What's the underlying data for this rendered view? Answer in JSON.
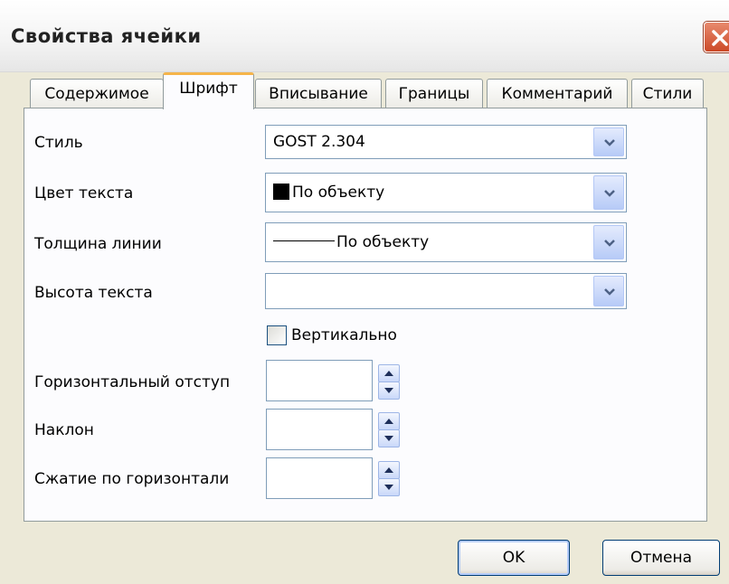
{
  "window": {
    "title": "Свойства ячейки"
  },
  "tabs": [
    {
      "label": "Содержимое",
      "active": false
    },
    {
      "label": "Шрифт",
      "active": true
    },
    {
      "label": "Вписывание",
      "active": false
    },
    {
      "label": "Границы",
      "active": false
    },
    {
      "label": "Комментарий",
      "active": false
    },
    {
      "label": "Стили",
      "active": false
    }
  ],
  "form": {
    "style": {
      "label": "Стиль",
      "value": "GOST 2.304"
    },
    "text_color": {
      "label": "Цвет текста",
      "value": "По объекту",
      "swatch_color": "#000000"
    },
    "line_weight": {
      "label": "Толщина линии",
      "value": "По объекту"
    },
    "text_height": {
      "label": "Высота текста",
      "value": ""
    },
    "vertical": {
      "label": "Вертикально",
      "checked": false
    },
    "horizontal_indent": {
      "label": "Горизонтальный отступ",
      "value": ""
    },
    "slant": {
      "label": "Наклон",
      "value": ""
    },
    "horizontal_compression": {
      "label": "Сжатие по горизонтали",
      "value": ""
    }
  },
  "buttons": {
    "ok": "OK",
    "cancel": "Отмена"
  },
  "icons": {
    "close": "close-icon",
    "dropdown": "chevron-down-icon",
    "spin_up": "arrow-up-icon",
    "spin_down": "arrow-down-icon"
  },
  "colors": {
    "active_tab_accent": "#f5b44a",
    "close_button": "#cc4a28",
    "input_border": "#7f9db9"
  }
}
